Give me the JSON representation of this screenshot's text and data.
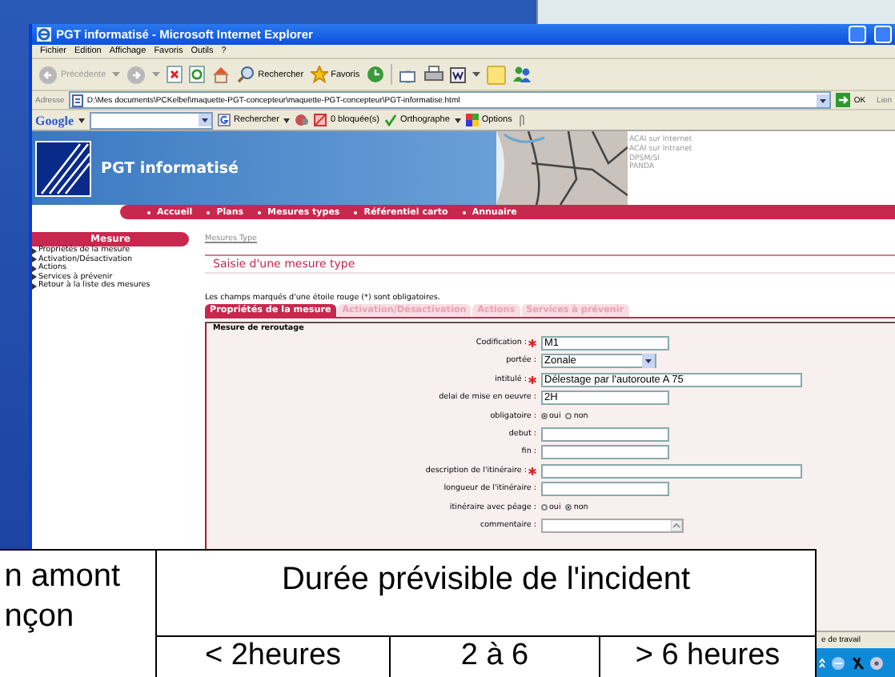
{
  "window": {
    "title": "PGT informatisé - Microsoft Internet Explorer"
  },
  "menu": [
    "Fichier",
    "Edition",
    "Affichage",
    "Favoris",
    "Outils",
    "?"
  ],
  "toolbar": {
    "back": "Précédente",
    "search": "Rechercher",
    "favorites": "Favoris"
  },
  "address": {
    "label": "Adresse",
    "value": "D:\\Mes documents\\PCKelbel\\maquette-PGT-concepteur\\maquette-PGT-concepteur\\PGT-informatise.html",
    "go": "OK",
    "links": "Lien"
  },
  "google_bar": {
    "logo": "Google",
    "search": "Rechercher",
    "blocked": "0 bloquée(s)",
    "spelling": "Orthographe",
    "options": "Options"
  },
  "banner": {
    "title": "PGT informatisé",
    "links": [
      "ACAI sur Internet",
      "ACAI sur Intranet",
      "DPSM/SI",
      "PANDA"
    ]
  },
  "nav": [
    "Accueil",
    "Plans",
    "Mesures types",
    "Référentiel carto",
    "Annuaire"
  ],
  "sidebar": {
    "title": "Mesure",
    "items": [
      "Propriétés de la mesure",
      "Activation/Désactivation",
      "Actions",
      "Services à prévenir",
      "Retour à la liste des mesures"
    ]
  },
  "breadcrumb": "Mesures Type",
  "page_title": "Saisie d'une mesure type",
  "note": "Les champs marqués d'une étoile rouge (*) sont obligatoires.",
  "tabs": [
    {
      "label": "Propriétés de la mesure",
      "selected": true
    },
    {
      "label": "Activation/Désactivation",
      "selected": false
    },
    {
      "label": "Actions",
      "selected": false
    },
    {
      "label": "Services à prévenir",
      "selected": false
    }
  ],
  "fieldset": {
    "legend": "Mesure de reroutage",
    "fields": [
      {
        "kind": "text",
        "label": "Codification :",
        "required": true,
        "value": "M1",
        "wide": false
      },
      {
        "kind": "select",
        "label": "portée :",
        "required": false,
        "value": "Zonale"
      },
      {
        "kind": "text",
        "label": "intitulé :",
        "required": true,
        "value": "Délestage par l'autoroute A 75",
        "wide": true
      },
      {
        "kind": "text",
        "label": "delai de mise en oeuvre :",
        "required": false,
        "value": "2H",
        "wide": false
      },
      {
        "kind": "radio",
        "label": "obligatoire :",
        "required": false,
        "options": [
          {
            "label": "oui",
            "selected": true
          },
          {
            "label": "non",
            "selected": false
          }
        ]
      },
      {
        "kind": "text",
        "label": "debut :",
        "required": false,
        "wide": false
      },
      {
        "kind": "text",
        "label": "fin :",
        "required": false,
        "wide": false
      },
      {
        "kind": "text",
        "label": "description de l'itinéraire :",
        "required": true,
        "wide": true
      },
      {
        "kind": "text",
        "label": "longueur de l'itinéraire :",
        "required": false,
        "wide": false
      },
      {
        "kind": "radio",
        "label": "itinéraire avec péage :",
        "required": false,
        "options": [
          {
            "label": "oui",
            "selected": false
          },
          {
            "label": "non",
            "selected": true
          }
        ]
      },
      {
        "kind": "textarea",
        "label": "commentaire :",
        "required": false
      }
    ]
  },
  "status_bar": {
    "text": "e de travail"
  },
  "overlay_table": {
    "column_1": [
      "n amont",
      "nçon"
    ],
    "header": "Durée prévisible de l'incident",
    "columns": [
      "< 2heures",
      "2 à 6",
      "> 6 heures"
    ]
  }
}
